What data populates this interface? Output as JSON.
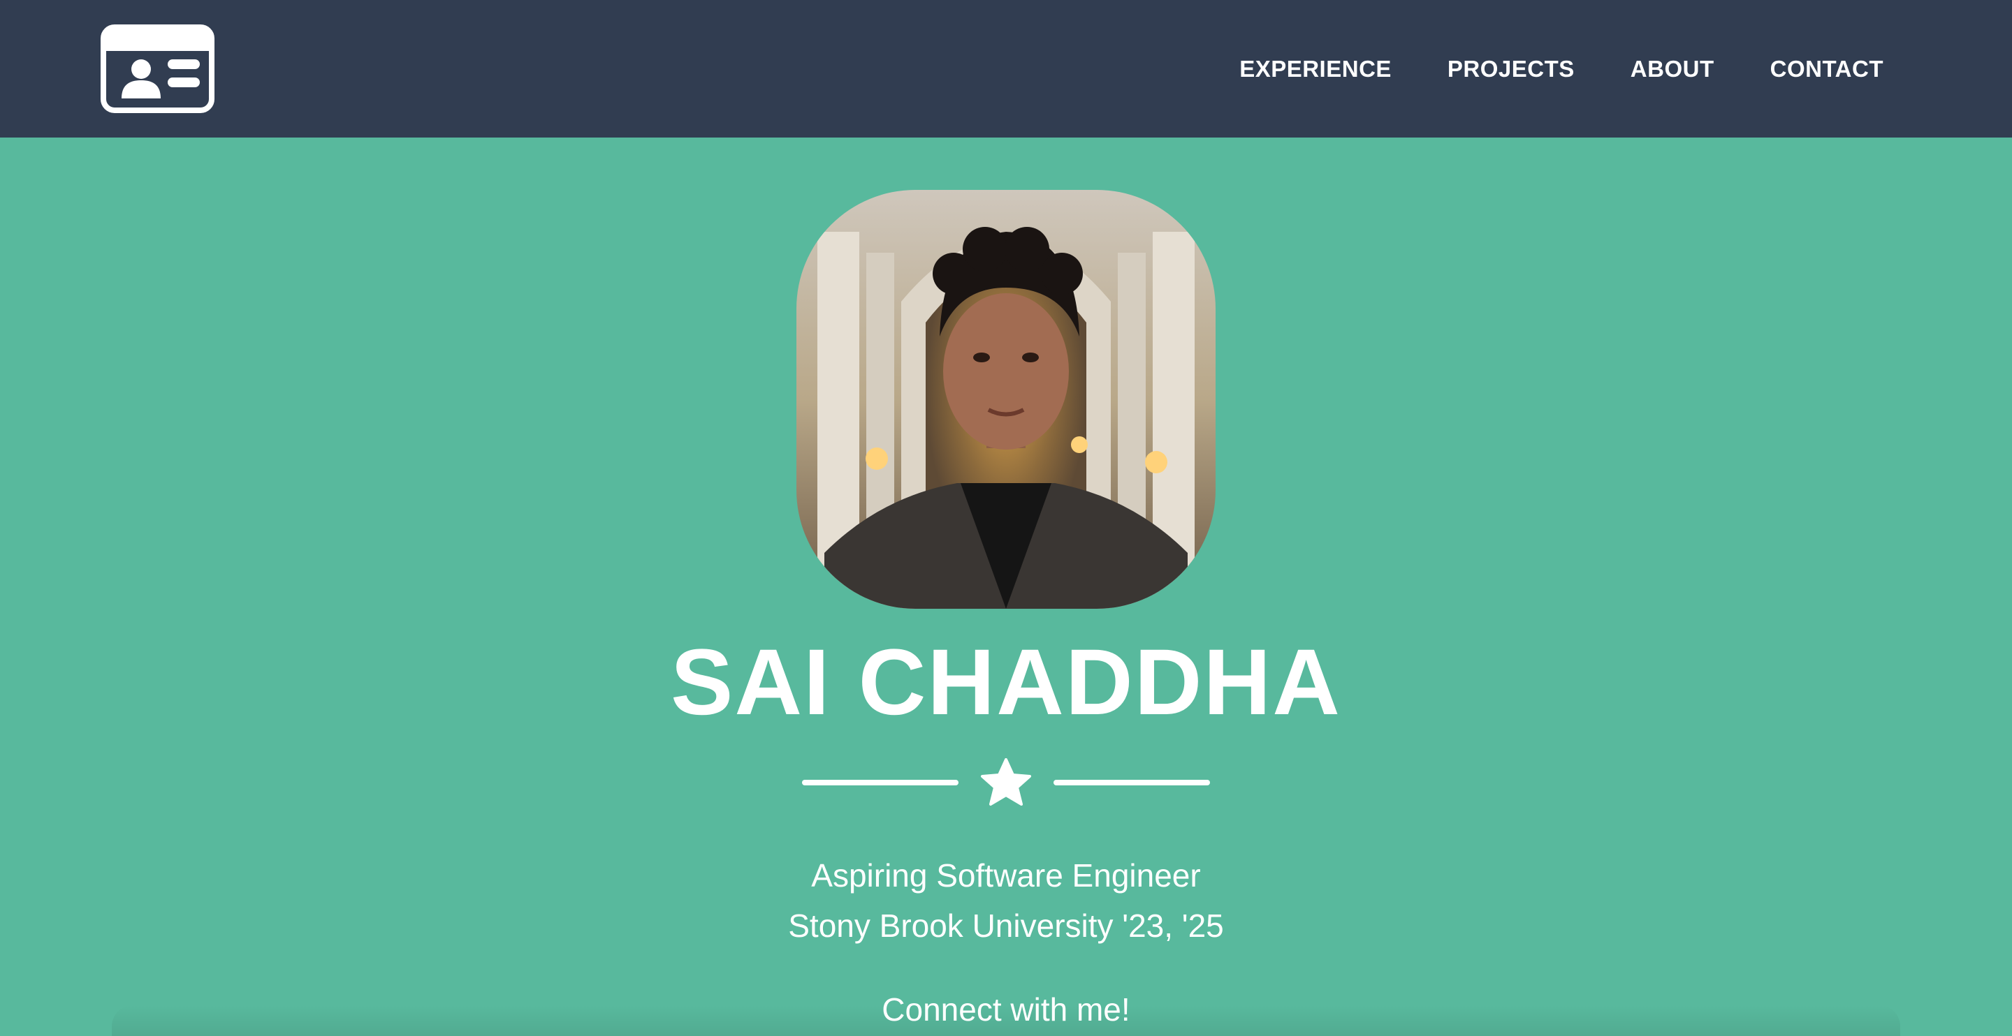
{
  "nav": {
    "brand_icon": "id-card-icon",
    "links": [
      {
        "label": "EXPERIENCE"
      },
      {
        "label": "PROJECTS"
      },
      {
        "label": "ABOUT"
      },
      {
        "label": "CONTACT"
      }
    ]
  },
  "masthead": {
    "avatar_alt": "profile-photo",
    "name": "SAI CHADDHA",
    "divider_icon": "star-icon",
    "subtitle_line1": "Aspiring Software Engineer",
    "subtitle_line2": "Stony Brook University '23, '25",
    "connect_text": "Connect with me!"
  },
  "colors": {
    "navbar": "#313d51",
    "masthead": "#58b99d",
    "text": "#ffffff"
  }
}
